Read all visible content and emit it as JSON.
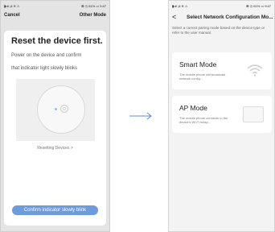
{
  "left_screen": {
    "status": {
      "left": "▮ull ᵢᵢll ≋ ⚠",
      "right": "⊠ ◷ 61% ▭ 9:47"
    },
    "nav": {
      "cancel": "Cancel",
      "other_mode": "Other Mode"
    },
    "title": "Reset the device first.",
    "instruction_line1": "Power on the device and confirm",
    "instruction_line2": "that indicator light slowly blinks",
    "resetting_link": "Resetting Devices >",
    "confirm_button": "Confirm indicator slowly blink"
  },
  "arrow_icon": "right-arrow-icon",
  "right_screen": {
    "status": {
      "left": "▮ull ᵢᵢll ≋ ⚠",
      "right": "⊠ ◷ 61% ▭ 9:47"
    },
    "nav": {
      "back": "<",
      "title": "Select Network Configuration Mo..."
    },
    "intro": "Select a correct pairing mode based on the device type or refer to the user manual.",
    "modes": [
      {
        "title": "Smart Mode",
        "description": "The mobile phone will broadcast network config...",
        "icon": "wifi-icon"
      },
      {
        "title": "AP Mode",
        "description": "The mobile phone connects to the device's Wi-Fi hotsp...",
        "icon": "device-box-icon"
      }
    ]
  },
  "colors": {
    "accent": "#6e9bdc",
    "background_left": "#e4e4e4",
    "background_right": "#f3f3f3"
  }
}
